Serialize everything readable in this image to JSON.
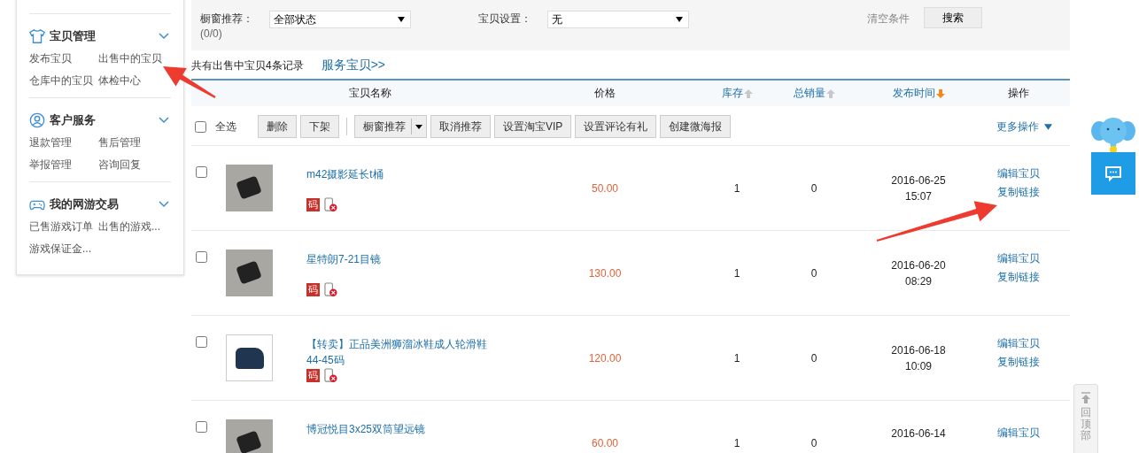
{
  "sidebar": {
    "sections": [
      {
        "title": "宝贝管理",
        "expanded": true,
        "links": [
          "发布宝贝",
          "出售中的宝贝",
          "仓库中的宝贝",
          "体检中心"
        ]
      },
      {
        "title": "客户服务",
        "expanded": true,
        "links": [
          "退款管理",
          "售后管理",
          "举报管理",
          "咨询回复"
        ]
      },
      {
        "title": "我的网游交易",
        "expanded": true,
        "links": [
          "已售游戏订单",
          "出售的游戏...",
          "游戏保证金..."
        ]
      }
    ]
  },
  "filters": {
    "fields": [
      {
        "label": "橱窗推荐：",
        "value": "全部状态",
        "note": "(0/0)"
      },
      {
        "label": "宝贝设置：",
        "value": "无"
      }
    ],
    "clear": "清空条件",
    "search": "搜索"
  },
  "summary": {
    "text": "共有出售中宝贝4条记录",
    "link": "服务宝贝>>"
  },
  "columns": [
    {
      "label": "宝贝名称",
      "sortable": false
    },
    {
      "label": "价格",
      "sortable": false
    },
    {
      "label": "库存",
      "sortable": true,
      "sorted": false
    },
    {
      "label": "总销量",
      "sortable": true,
      "sorted": false
    },
    {
      "label": "发布时间",
      "sortable": true,
      "sorted": true
    },
    {
      "label": "操作",
      "sortable": false
    }
  ],
  "toolbar": {
    "select_all": {
      "label": "全选",
      "checked": false
    },
    "buttons": [
      {
        "label": "删除",
        "kind": "plain"
      },
      {
        "label": "下架",
        "kind": "plain"
      },
      {
        "label": "橱窗推荐",
        "kind": "split"
      },
      {
        "label": "取消推荐",
        "kind": "plain"
      },
      {
        "label": "设置淘宝VIP",
        "kind": "plain"
      },
      {
        "label": "设置评论有礼",
        "kind": "plain"
      },
      {
        "label": "创建微海报",
        "kind": "plain"
      }
    ],
    "more": "更多操作"
  },
  "rows": [
    {
      "checked": false,
      "name": "m42摄影延长t桶",
      "badge": "码",
      "price": "50.00",
      "stock": "1",
      "sales": "0",
      "date": "2016-06-25",
      "time": "15:07",
      "actions": [
        "编辑宝贝",
        "复制链接"
      ]
    },
    {
      "checked": false,
      "name": "星特朗7-21目镜",
      "badge": "码",
      "price": "130.00",
      "stock": "1",
      "sales": "0",
      "date": "2016-06-20",
      "time": "08:29",
      "actions": [
        "编辑宝贝",
        "复制链接"
      ]
    },
    {
      "checked": false,
      "name": "【转卖】正品美洲狮溜冰鞋成人轮滑鞋44-45码",
      "badge": "码",
      "price": "120.00",
      "stock": "1",
      "sales": "0",
      "date": "2016-06-18",
      "time": "10:09",
      "actions": [
        "编辑宝贝",
        "复制链接"
      ]
    },
    {
      "checked": false,
      "name": "博冠悦目3x25双筒望远镜",
      "price": "60.00",
      "stock": "1",
      "sales": "0",
      "date": "2016-06-14",
      "actions": [
        "编辑宝贝"
      ]
    }
  ],
  "back_to_top": "回顶部"
}
